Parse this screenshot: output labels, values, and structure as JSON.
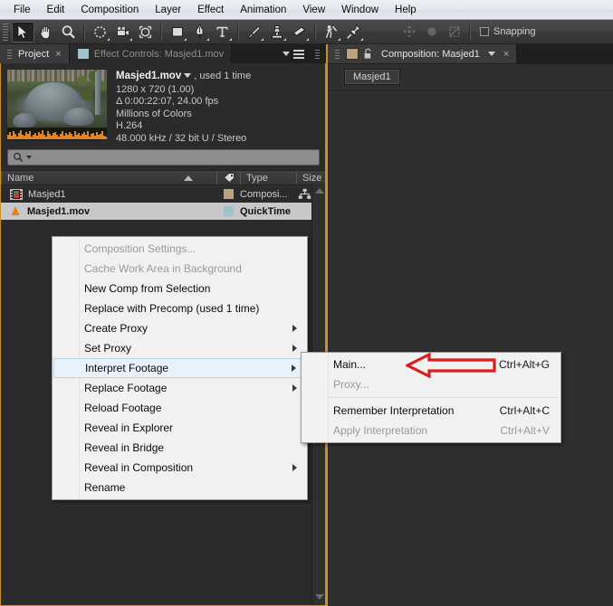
{
  "menubar": {
    "items": [
      {
        "label": "File"
      },
      {
        "label": "Edit"
      },
      {
        "label": "Composition"
      },
      {
        "label": "Layer"
      },
      {
        "label": "Effect"
      },
      {
        "label": "Animation"
      },
      {
        "label": "View"
      },
      {
        "label": "Window"
      },
      {
        "label": "Help"
      }
    ]
  },
  "toolbar": {
    "tools": [
      {
        "name": "selection-tool",
        "active": true
      },
      {
        "name": "hand-tool",
        "active": false
      },
      {
        "name": "zoom-tool",
        "active": false
      },
      {
        "name": "rotation-tool",
        "active": false
      },
      {
        "name": "camera-tool",
        "active": false
      },
      {
        "name": "pan-behind-tool",
        "active": false
      },
      {
        "name": "shape-tool",
        "active": false
      },
      {
        "name": "pen-tool",
        "active": false
      },
      {
        "name": "text-tool",
        "active": false
      },
      {
        "name": "brush-tool",
        "active": false
      },
      {
        "name": "clone-stamp-tool",
        "active": false
      },
      {
        "name": "eraser-tool",
        "active": false
      },
      {
        "name": "roto-brush-tool",
        "active": false
      },
      {
        "name": "puppet-pin-tool",
        "active": false
      }
    ],
    "snapping_label": "Snapping",
    "snapping_checked": false
  },
  "project_panel": {
    "tabs": [
      {
        "label": "Project",
        "selected": true,
        "closable": true
      },
      {
        "label": "Effect Controls: Masjed1.mov",
        "selected": false,
        "closable": false
      }
    ],
    "footage_info": {
      "filename": "Masjed1.mov",
      "usage": ", used 1 time",
      "resolution": "1280 x 720 (1.00)",
      "duration": "Δ 0:00:22:07, 24.00 fps",
      "color_depth": "Millions of Colors",
      "codec": "H.264",
      "audio": "48.000 kHz / 32 bit U / Stereo"
    },
    "search": {
      "value": "",
      "placeholder": ""
    },
    "columns": [
      {
        "label": "Name",
        "sorted": "asc"
      },
      {
        "label": ""
      },
      {
        "label": "Type"
      },
      {
        "label": "Size"
      }
    ],
    "rows": [
      {
        "name": "Masjed1",
        "icon": "composition-icon",
        "swatch": "#b9a37e",
        "type": "Composi...",
        "size": "",
        "selected": false
      },
      {
        "name": "Masjed1.mov",
        "icon": "quicktime-cone-icon",
        "swatch": "#9fc3c8",
        "type": "QuickTime",
        "size": "",
        "selected": true
      }
    ]
  },
  "comp_panel": {
    "tab_label": "Composition: Masjed1",
    "breadcrumb": "Masjed1"
  },
  "context_menu": {
    "items": [
      {
        "label": "Composition Settings...",
        "disabled": true,
        "submenu": false,
        "accel": ""
      },
      {
        "label": "Cache Work Area in Background",
        "disabled": true,
        "submenu": false,
        "accel": ""
      },
      {
        "label": "New Comp from Selection",
        "disabled": false,
        "submenu": false,
        "accel": ""
      },
      {
        "label": "Replace with Precomp (used 1 time)",
        "disabled": false,
        "submenu": false,
        "accel": ""
      },
      {
        "label": "Create Proxy",
        "disabled": false,
        "submenu": true,
        "accel": ""
      },
      {
        "label": "Set Proxy",
        "disabled": false,
        "submenu": true,
        "accel": ""
      },
      {
        "label": "Interpret Footage",
        "disabled": false,
        "submenu": true,
        "accel": "",
        "highlighted": true
      },
      {
        "label": "Replace Footage",
        "disabled": false,
        "submenu": true,
        "accel": ""
      },
      {
        "label": "Reload Footage",
        "disabled": false,
        "submenu": false,
        "accel": ""
      },
      {
        "label": "Reveal in Explorer",
        "disabled": false,
        "submenu": false,
        "accel": ""
      },
      {
        "label": "Reveal in Bridge",
        "disabled": false,
        "submenu": false,
        "accel": ""
      },
      {
        "label": "Reveal in Composition",
        "disabled": false,
        "submenu": true,
        "accel": ""
      },
      {
        "label": "Rename",
        "disabled": false,
        "submenu": false,
        "accel": ""
      }
    ]
  },
  "submenu": {
    "items": [
      {
        "label": "Main...",
        "accel": "Ctrl+Alt+G",
        "disabled": false
      },
      {
        "label": "Proxy...",
        "accel": "",
        "disabled": true
      },
      {
        "separator": true
      },
      {
        "label": "Remember Interpretation",
        "accel": "Ctrl+Alt+C",
        "disabled": false
      },
      {
        "label": "Apply Interpretation",
        "accel": "Ctrl+Alt+V",
        "disabled": true
      }
    ]
  },
  "annotation": {
    "arrow_color": "#d81f1f",
    "points_to": "Main..."
  }
}
